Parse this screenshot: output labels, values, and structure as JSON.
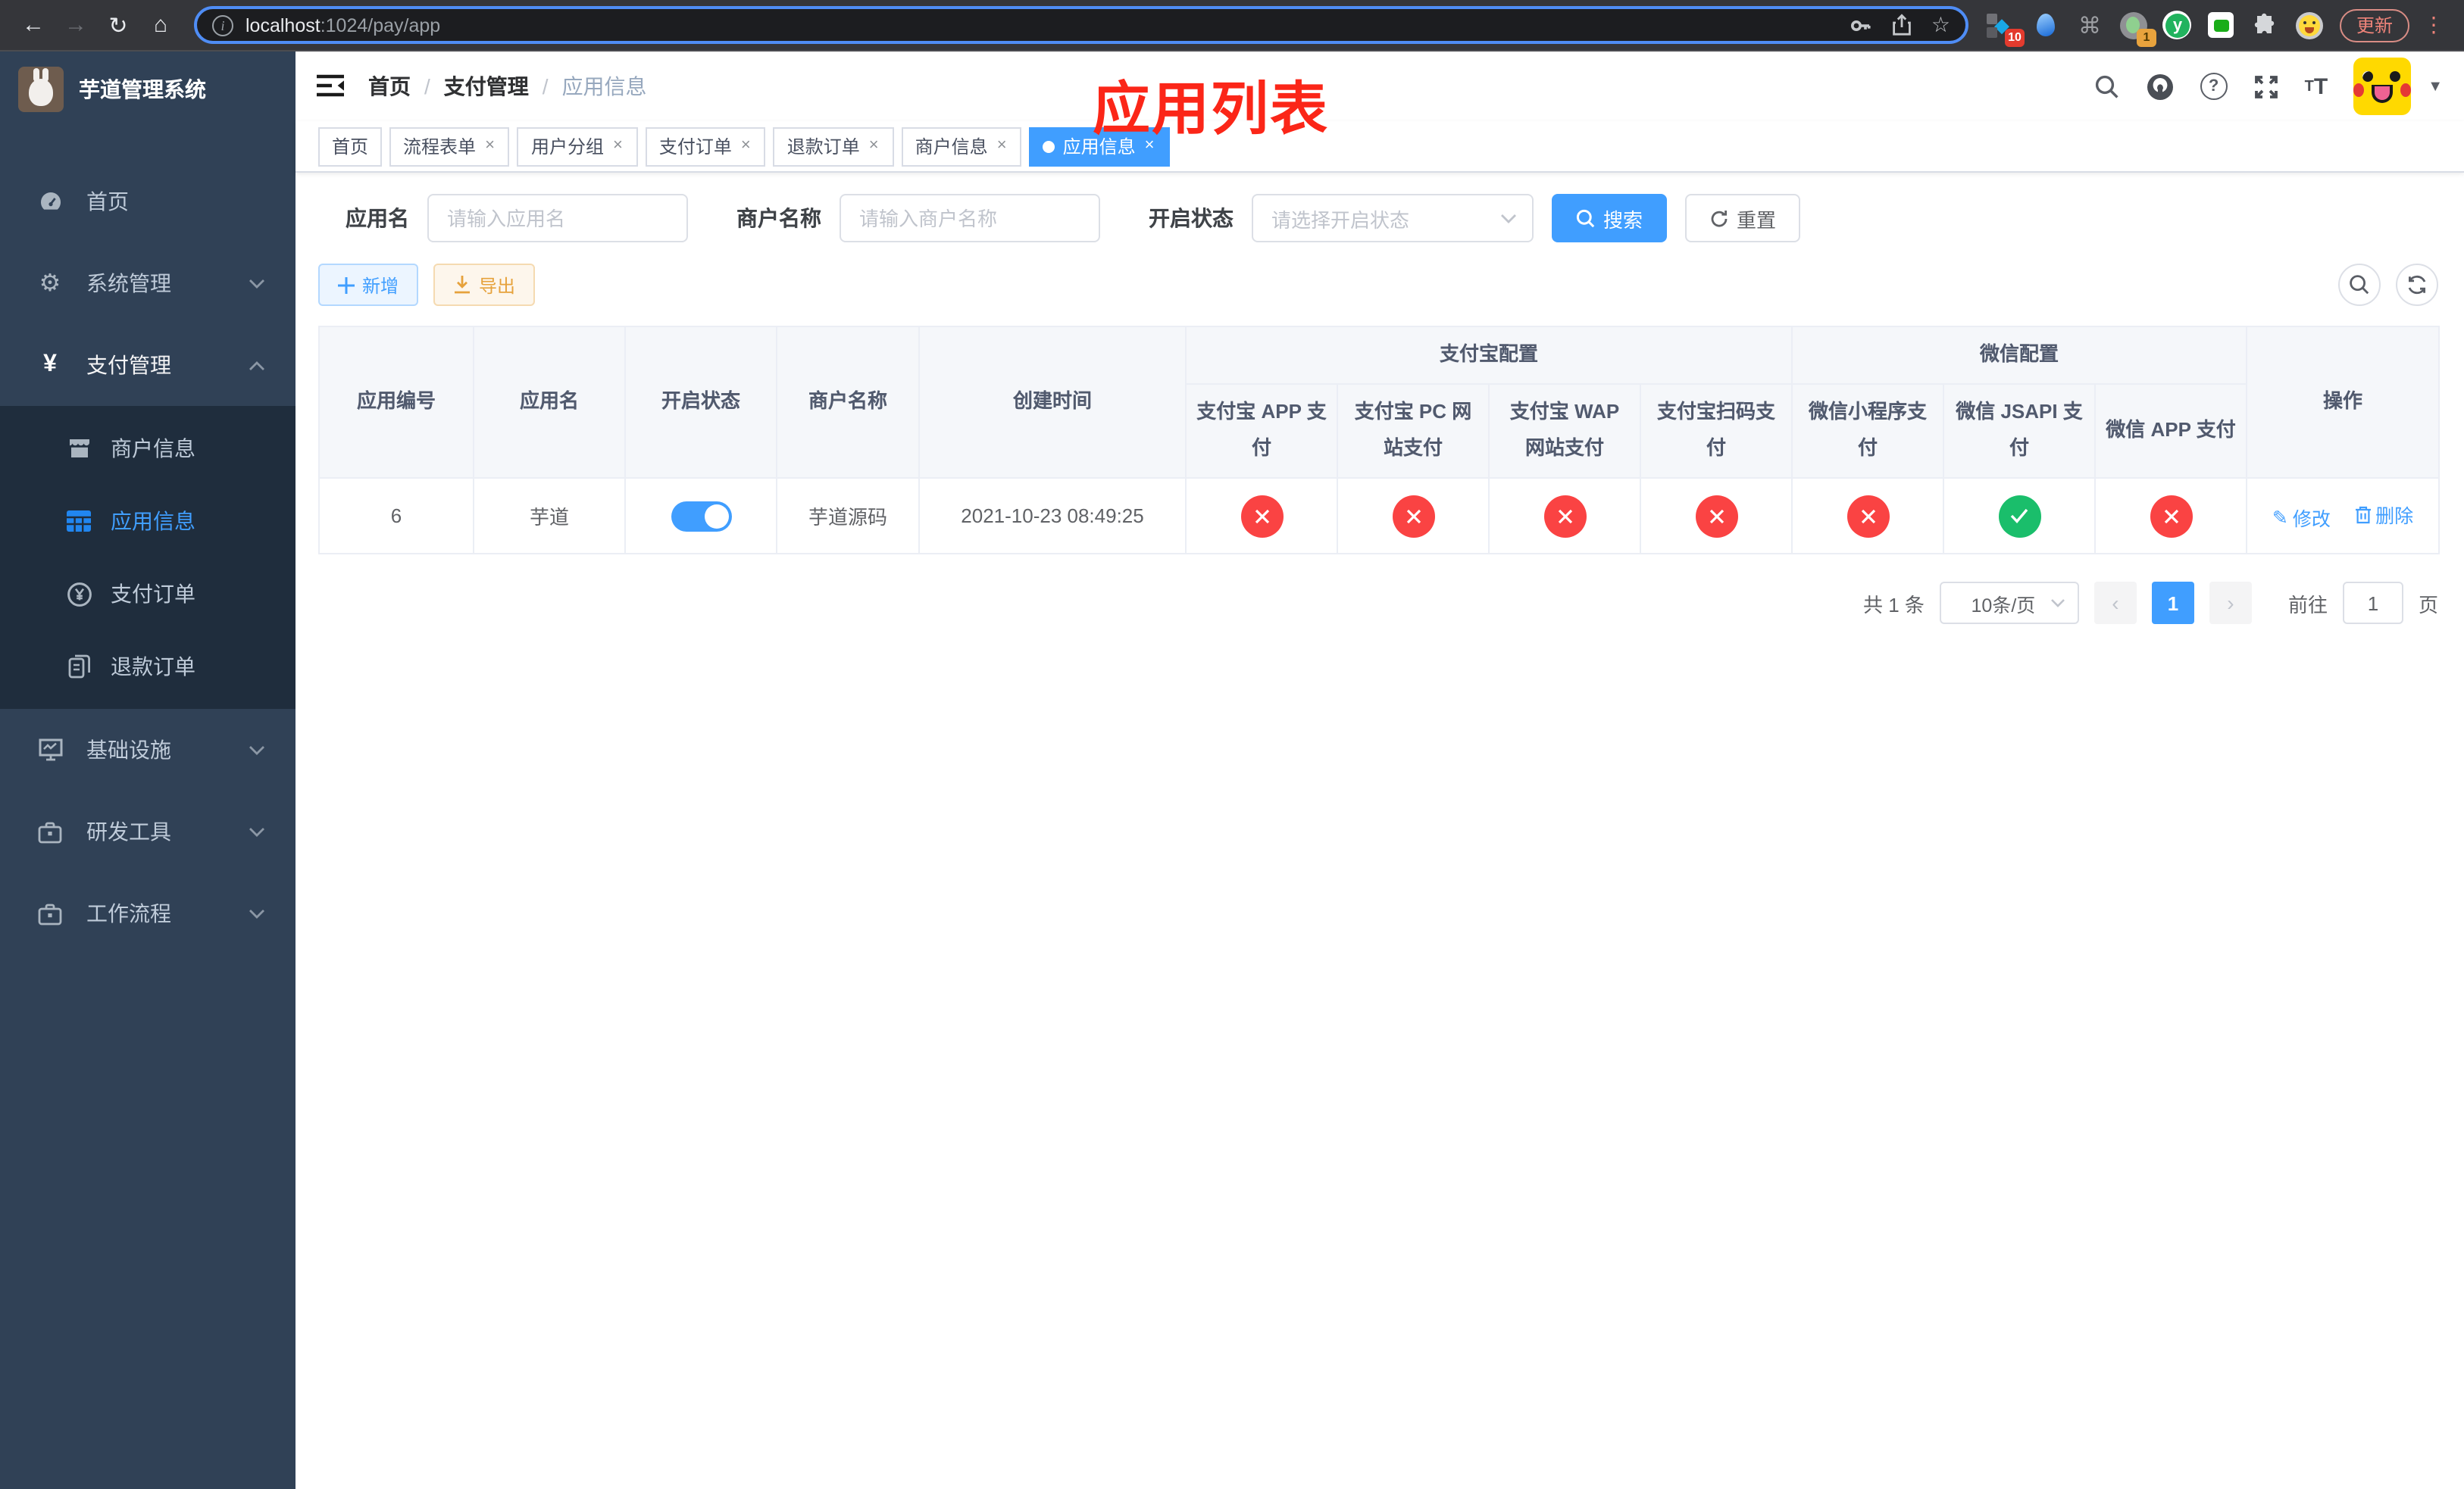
{
  "browser": {
    "url_host": "localhost",
    "url_path": ":1024/pay/app",
    "update_label": "更新",
    "badges": {
      "extensions": "10",
      "profile": "1"
    }
  },
  "glyphs": {
    "back": "←",
    "forward": "→",
    "reload": "↻",
    "home": "⌂",
    "info": "i",
    "star": "☆",
    "command": "⌘",
    "diamond": "◆",
    "kebab": "⋮",
    "caret": "▼",
    "help": "?",
    "font_size": "T",
    "font_size_small": "T",
    "y_ext": "y",
    "yen": "¥",
    "gear": "⚙",
    "edit": "✎",
    "close": "×",
    "dot_sep": "/",
    "prev": "‹",
    "next": "›",
    "plus": "＋"
  },
  "sidebar": {
    "title": "芋道管理系统",
    "items": [
      {
        "label": "首页"
      },
      {
        "label": "系统管理"
      },
      {
        "label": "支付管理"
      },
      {
        "label": "基础设施"
      },
      {
        "label": "研发工具"
      },
      {
        "label": "工作流程"
      }
    ],
    "submenu": [
      {
        "label": "商户信息"
      },
      {
        "label": "应用信息"
      },
      {
        "label": "支付订单"
      },
      {
        "label": "退款订单"
      }
    ]
  },
  "breadcrumb": {
    "items": [
      "首页",
      "支付管理",
      "应用信息"
    ],
    "separator": "/"
  },
  "tabs": [
    {
      "label": "首页"
    },
    {
      "label": "流程表单"
    },
    {
      "label": "用户分组"
    },
    {
      "label": "支付订单"
    },
    {
      "label": "退款订单"
    },
    {
      "label": "商户信息"
    },
    {
      "label": "应用信息"
    }
  ],
  "overlay_title": {
    "text": "应用列表",
    "color": "#fb2618"
  },
  "filters": {
    "app_name_label": "应用名",
    "app_name_placeholder": "请输入应用名",
    "merchant_label": "商户名称",
    "merchant_placeholder": "请输入商户名称",
    "status_label": "开启状态",
    "status_placeholder": "请选择开启状态",
    "search_label": "搜索",
    "reset_label": "重置"
  },
  "actions": {
    "add_label": "新增",
    "export_label": "导出"
  },
  "table": {
    "col_app_id": "应用编号",
    "col_app_name": "应用名",
    "col_status": "开启状态",
    "col_merchant": "商户名称",
    "col_created": "创建时间",
    "group_alipay": "支付宝配置",
    "group_wechat": "微信配置",
    "pay_cols": [
      "支付宝 APP 支付",
      "支付宝 PC 网站支付",
      "支付宝 WAP 网站支付",
      "支付宝扫码支付",
      "微信小程序支付",
      "微信 JSAPI 支付",
      "微信 APP 支付"
    ],
    "col_ops": "操作",
    "row": {
      "app_id": "6",
      "app_name": "芋道",
      "status_on": true,
      "merchant": "芋道源码",
      "created": "2021-10-23 08:49:25",
      "pay_status": [
        "disabled",
        "disabled",
        "disabled",
        "disabled",
        "disabled",
        "enabled",
        "disabled"
      ],
      "edit_label": "修改",
      "delete_label": "删除"
    }
  },
  "pagination": {
    "total": "共 1 条",
    "page_size": "10条/页",
    "current_page": "1",
    "goto_label": "前往",
    "goto_value": "1",
    "page_suffix": "页"
  },
  "colors": {
    "accent": "#409EFF",
    "success": "#1abe6b",
    "danger": "#fa4343",
    "warning": "#e6a23c",
    "sidebar_bg": "#304156",
    "submenu_bg": "#1f2d3d",
    "overlay_title": "#fb2618",
    "browser_bar": "#35363a"
  }
}
